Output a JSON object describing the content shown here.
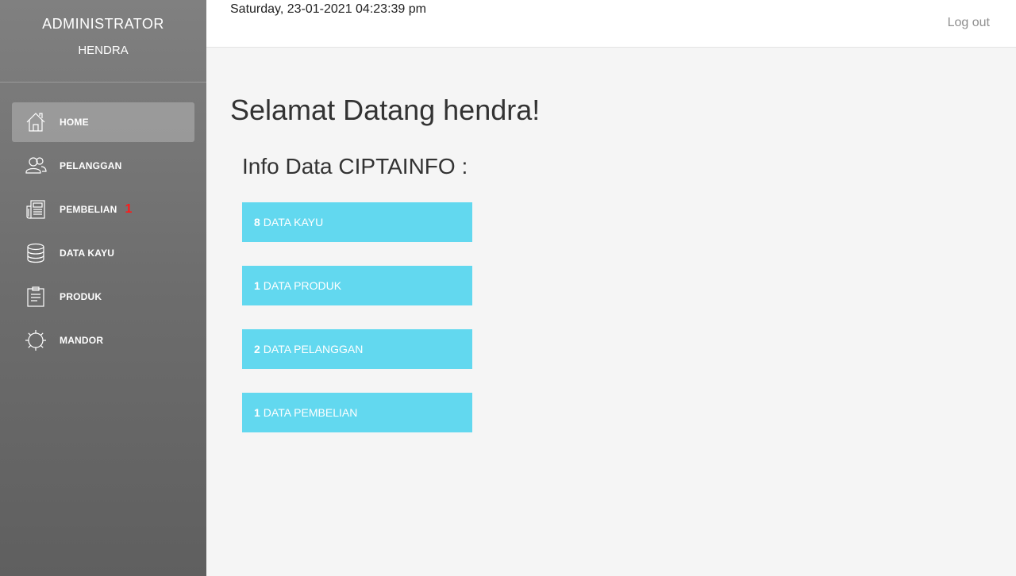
{
  "sidebar": {
    "role": "ADMINISTRATOR",
    "user": "HENDRA",
    "items": [
      {
        "label": "HOME",
        "icon": "home-icon",
        "active": true
      },
      {
        "label": "PELANGGAN",
        "icon": "users-icon"
      },
      {
        "label": "PEMBELIAN",
        "icon": "newspaper-icon",
        "badge": "1"
      },
      {
        "label": "DATA KAYU",
        "icon": "database-icon"
      },
      {
        "label": "PRODUK",
        "icon": "clipboard-icon"
      },
      {
        "label": "MANDOR",
        "icon": "gear-icon"
      }
    ]
  },
  "topbar": {
    "datetime": "Saturday, 23-01-2021 04:23:39 pm",
    "logout": "Log out"
  },
  "main": {
    "welcome": "Selamat Datang hendra!",
    "subtitle": "Info Data CIPTAINFO :",
    "stats": [
      {
        "count": "8",
        "label": "DATA KAYU"
      },
      {
        "count": "1",
        "label": "DATA PRODUK"
      },
      {
        "count": "2",
        "label": "DATA PELANGGAN"
      },
      {
        "count": "1",
        "label": "DATA PEMBELIAN"
      }
    ]
  },
  "colors": {
    "accent": "#62d8ef",
    "badge": "#ff1a1a"
  }
}
